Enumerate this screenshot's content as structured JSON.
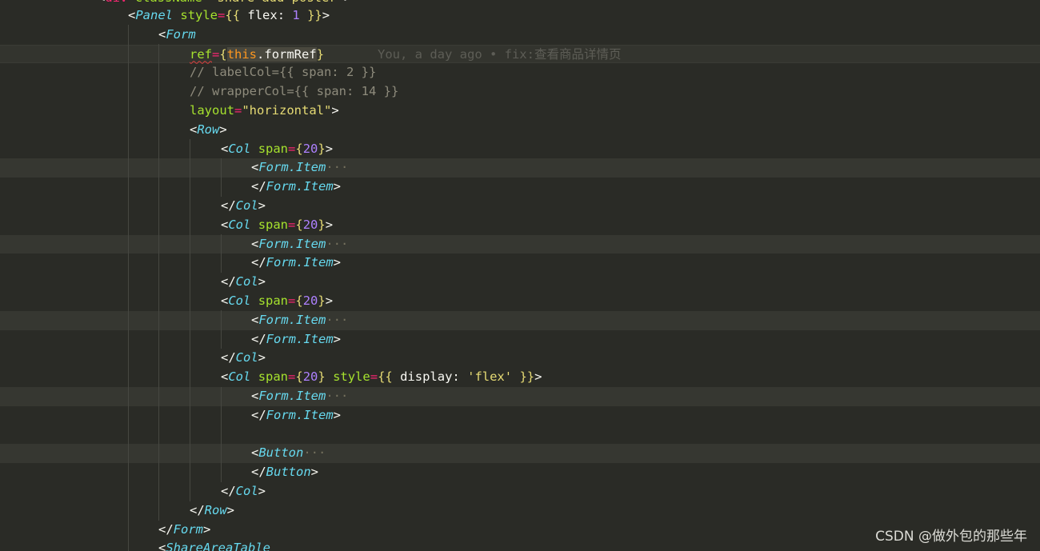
{
  "editor": {
    "lines": [
      {
        "text": "<div className=\"share-add-poster\">"
      },
      {
        "text": "<Panel style={{ flex: 1 }}>"
      },
      {
        "text": "<Form"
      },
      {
        "text": "ref={this.formRef}"
      },
      {
        "text": "// labelCol={{ span: 2 }}"
      },
      {
        "text": "// wrapperCol={{ span: 14 }}"
      },
      {
        "text": "layout=\"horizontal\">"
      },
      {
        "text": "<Row>"
      },
      {
        "text": "<Col span={20}>"
      },
      {
        "text": "<Form.Item"
      },
      {
        "text": "</Form.Item>"
      },
      {
        "text": "</Col>"
      },
      {
        "text": "<Col span={20}>"
      },
      {
        "text": "<Form.Item"
      },
      {
        "text": "</Form.Item>"
      },
      {
        "text": "</Col>"
      },
      {
        "text": "<Col span={20}>"
      },
      {
        "text": "<Form.Item"
      },
      {
        "text": "</Form.Item>"
      },
      {
        "text": "</Col>"
      },
      {
        "text": "<Col span={20} style={{ display: 'flex' }}>"
      },
      {
        "text": "<Form.Item"
      },
      {
        "text": "</Form.Item>"
      },
      {
        "text": ""
      },
      {
        "text": "<Button"
      },
      {
        "text": "</Button>"
      },
      {
        "text": "</Col>"
      },
      {
        "text": "</Row>"
      },
      {
        "text": "</Form>"
      },
      {
        "text": "<ShareAreaTable"
      }
    ],
    "blame": "You, a day ago • fix:查看商品详情页",
    "fold_marker": "···"
  },
  "icons": {
    "lightbulb": "lightbulb-icon"
  },
  "colors": {
    "background": "#2a2b26",
    "tag": "#66d9ef",
    "attr": "#a6e22e",
    "operator": "#f92672",
    "number": "#ae81ff",
    "string": "#e6db74",
    "comment": "#8e8b7c",
    "lightbulb": "#f5c518"
  },
  "watermark": "CSDN @做外包的那些年"
}
